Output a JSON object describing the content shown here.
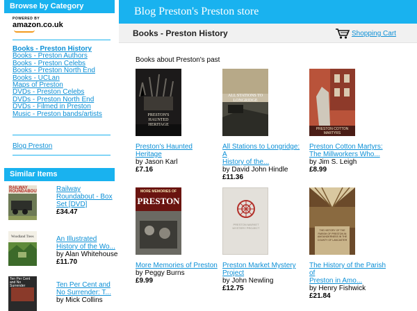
{
  "sidebar": {
    "browse_title": "Browse by Category",
    "amazon_powered": "POWERED BY",
    "amazon_logo": "amazon.co.uk",
    "categories": [
      "Books - Preston History",
      "Books - Preston Authors",
      "Books - Preston Celebs",
      "Books - Preston North End",
      "Books - UCLan",
      "Maps of Preston",
      "DVDs - Preston Celebs",
      "DVDs - Preston North End",
      "DVDs - Filmed in Preston",
      "Music - Preston bands/artists"
    ],
    "blog_link": "Blog Preston",
    "similar_title": "Similar Items",
    "similar": [
      {
        "title": "Railway Roundabout - Box Set [DVD]",
        "title_lines": [
          "Railway",
          "Roundabout - Box",
          "Set [DVD]"
        ],
        "by": "",
        "price": "£34.47",
        "cover_text": "RAILWAY ROUNDABOUT"
      },
      {
        "title_lines": [
          "An Illustrated",
          "History of the Wo..."
        ],
        "by": "by Alan Whitehouse",
        "price": "£11.70",
        "cover_text": "Woodland Trees"
      },
      {
        "title_lines": [
          "Ten Per Cent and",
          "No Surrender: T..."
        ],
        "by": "by Mick Collins",
        "price": "",
        "cover_text": "Ten Per Cent and No Surrender"
      }
    ]
  },
  "header": {
    "site_title": "Blog Preston's Preston store",
    "page_title": "Books - Preston History",
    "cart_label": "Shopping Cart"
  },
  "main": {
    "intro": "Books about Preston's past",
    "books": [
      {
        "title_lines": [
          "Preston's Haunted",
          "Heritage"
        ],
        "by": "by Jason Karl",
        "price": "£7.16",
        "cover_text": "PRESTON'S HAUNTED HERITAGE"
      },
      {
        "title_lines": [
          "All Stations to Longridge: A",
          "History of the..."
        ],
        "by": "by David John Hindle",
        "price": "£11.36",
        "cover_text": "ALL STATIONS TO LONGRIDGE"
      },
      {
        "title_lines": [
          "Preston Cotton Martyrs:",
          "The Millworkers Who..."
        ],
        "by": "by Jim S. Leigh",
        "price": "£8.99",
        "cover_text": "PRESTON COTTON MARTYRS"
      },
      {
        "title_lines": [
          "More Memories of Preston"
        ],
        "by": "by Peggy Burns",
        "price": "£9.99",
        "cover_text": "MORE MEMORIES OF",
        "cover_text2": "PRESTON"
      },
      {
        "title_lines": [
          "Preston Market Mystery",
          "Project"
        ],
        "by": "by John Newling",
        "price": "£12.75",
        "cover_text": "PRESTON MARKET MYSTERY PROJECT"
      },
      {
        "title_lines": [
          "The History of the Parish of",
          "Preston in Amo..."
        ],
        "by": "by Henry Fishwick",
        "price": "£21.84",
        "cover_text": "THE HISTORY OF THE PARISH OF PRESTON IN AMOUNDERNESS IN THE COUNTY OF LANCASTER"
      }
    ]
  },
  "colors": {
    "accent": "#19b2ef",
    "link": "#0b8fd6",
    "subbar": "#f1f1f1",
    "amazon_orange": "#f29a1e"
  }
}
